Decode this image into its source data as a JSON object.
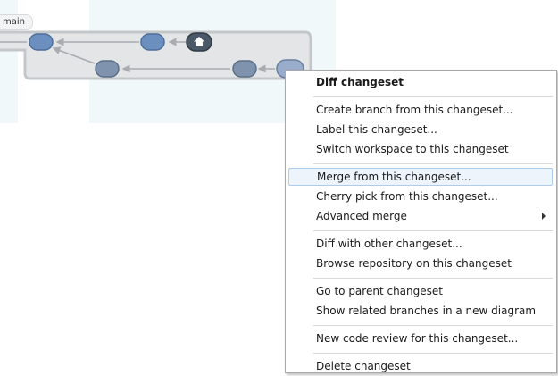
{
  "branch": {
    "label": "main"
  },
  "menu": {
    "groups": [
      [
        {
          "label": "Diff changeset",
          "bold": true
        }
      ],
      [
        {
          "label": "Create branch from this changeset..."
        },
        {
          "label": "Label this changeset..."
        },
        {
          "label": "Switch workspace to this changeset"
        }
      ],
      [
        {
          "label": "Merge from this changeset...",
          "highlighted": true
        },
        {
          "label": "Cherry pick from this changeset..."
        },
        {
          "label": "Advanced merge",
          "submenu": true
        }
      ],
      [
        {
          "label": "Diff with other changeset..."
        },
        {
          "label": "Browse repository on this changeset"
        }
      ],
      [
        {
          "label": "Go to parent changeset"
        },
        {
          "label": "Show related branches in a new diagram"
        }
      ],
      [
        {
          "label": "New code review for this changeset..."
        }
      ],
      [
        {
          "label": "Delete changeset"
        }
      ]
    ]
  },
  "colors": {
    "node": "#6b8fbf",
    "node_alt": "#7f93ae",
    "home_node": "#4a5868",
    "branch_bg": "#e3e5e6"
  },
  "icons": {
    "home": "home-icon",
    "submenu": "chevron-right-icon"
  }
}
